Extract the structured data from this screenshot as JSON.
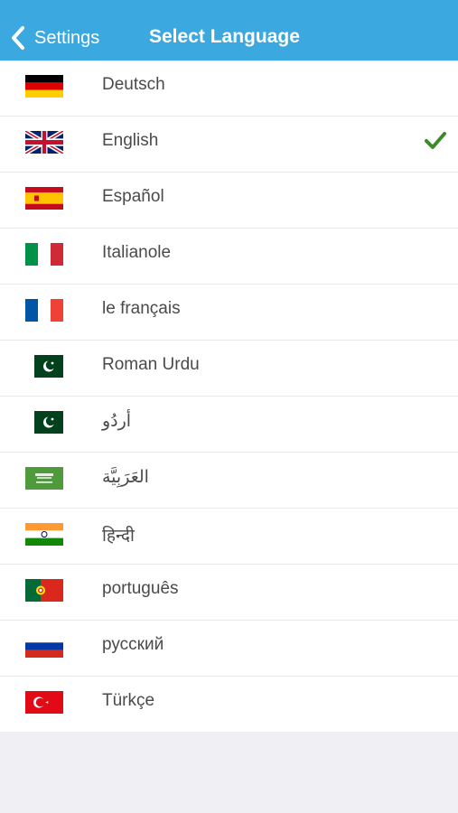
{
  "navbar": {
    "back_label": "Settings",
    "title": "Select Language",
    "background_color": "#3ba9e0"
  },
  "languages": [
    {
      "label": "Deutsch",
      "flag": "germany-flag-icon",
      "selected": false
    },
    {
      "label": "English",
      "flag": "uk-flag-icon",
      "selected": true
    },
    {
      "label": "Español",
      "flag": "spain-flag-icon",
      "selected": false
    },
    {
      "label": "Italianole",
      "flag": "italy-flag-icon",
      "selected": false
    },
    {
      "label": "le français",
      "flag": "france-flag-icon",
      "selected": false
    },
    {
      "label": "Roman Urdu",
      "flag": "pakistan-flag-icon",
      "selected": false
    },
    {
      "label": "أردُو",
      "flag": "pakistan-flag-icon",
      "selected": false
    },
    {
      "label": "العَرَبِيَّة",
      "flag": "saudi-arabia-flag-icon",
      "selected": false
    },
    {
      "label": "हिन्दी",
      "flag": "india-flag-icon",
      "selected": false
    },
    {
      "label": "português",
      "flag": "portugal-flag-icon",
      "selected": false
    },
    {
      "label": "русский",
      "flag": "russia-flag-icon",
      "selected": false
    },
    {
      "label": "Türkçe",
      "flag": "turkey-flag-icon",
      "selected": false
    }
  ],
  "check_icon": "checkmark-icon",
  "check_color": "#3d8a2a"
}
